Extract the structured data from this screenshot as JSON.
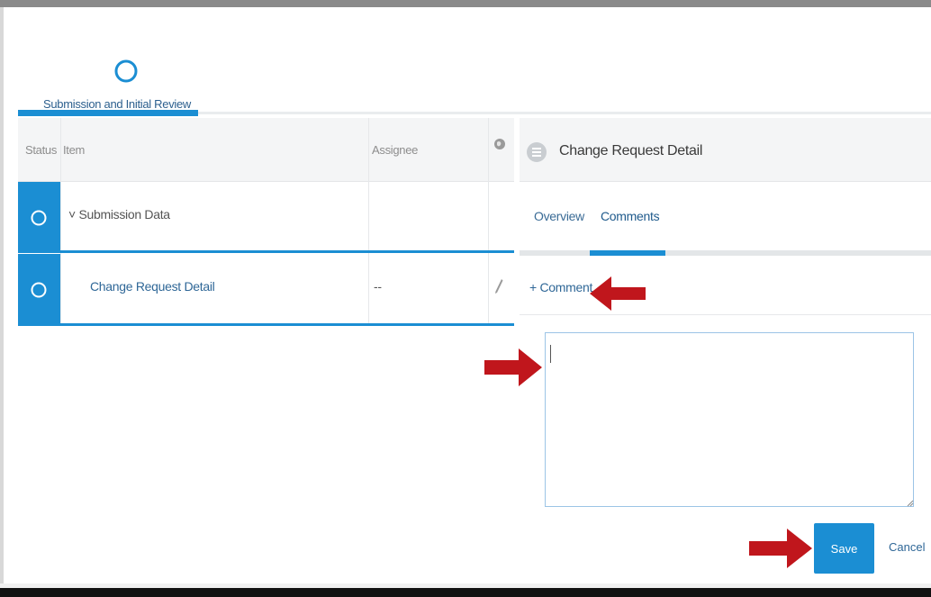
{
  "stage": {
    "label": "Submission and Initial Review",
    "icon": "progress-circle-icon"
  },
  "table": {
    "headers": {
      "status": "Status",
      "item": "Item",
      "assignee": "Assignee",
      "extra_icon": "globe-icon"
    },
    "rows": [
      {
        "item": "˅ Submission Data",
        "assignee": "",
        "status_icon": "progress-circle-icon"
      },
      {
        "item": "Change Request Detail",
        "assignee": "--",
        "status_icon": "progress-circle-icon",
        "action_icon": "pencil-icon"
      }
    ]
  },
  "detail": {
    "title": "Change Request Detail",
    "icon": "list-icon",
    "tabs": [
      {
        "label": "Overview",
        "active": false
      },
      {
        "label": "Comments",
        "active": true
      }
    ],
    "add_comment_label": "+ Comment",
    "comment_value": "",
    "save_label": "Save",
    "cancel_label": "Cancel"
  },
  "colors": {
    "accent": "#1b8ed3",
    "annotation_arrow": "#c0161c",
    "link": "#2f6797"
  }
}
